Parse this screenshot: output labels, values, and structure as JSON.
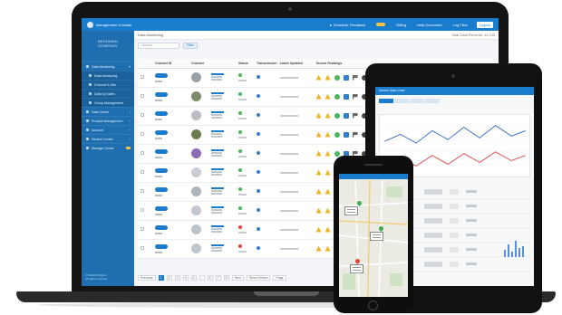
{
  "laptop": {
    "topbar": {
      "brand": "Management Console",
      "user_link": "Schedule Feedback",
      "items": [
        "Billing",
        "Help Document",
        "Log Files"
      ],
      "logout_label": "Logout"
    },
    "sidebar": {
      "logo_line1": "BEHUMAN",
      "logo_line2": "COMPANY",
      "items": [
        {
          "label": "Data Monitoring",
          "type": "main"
        },
        {
          "label": "Data Monitoring",
          "type": "sub"
        },
        {
          "label": "Channel & Site",
          "type": "sub"
        },
        {
          "label": "Data by Dates",
          "type": "sub"
        },
        {
          "label": "Group Management",
          "type": "sub"
        },
        {
          "label": "Data Center",
          "type": "main"
        },
        {
          "label": "Product Management",
          "type": "main"
        },
        {
          "label": "Account",
          "type": "main"
        },
        {
          "label": "Service Center",
          "type": "main"
        },
        {
          "label": "Manage Center",
          "type": "main"
        }
      ],
      "footer_line1": "© 2019 All Rights",
      "footer_line2": "All rights reserved"
    },
    "breadcrumb": "Data Monitoring",
    "breadcrumb_right": "Total Data Records: 11,130",
    "search_placeholder": "Search",
    "filter_button": "Filter",
    "table": {
      "headers": [
        "",
        "Channel ID",
        "Channel",
        "",
        "Status",
        "Transmission",
        "Latest Updated",
        "Sensor Readings"
      ],
      "rows": [
        {
          "status": "green"
        },
        {
          "status": "green"
        },
        {
          "status": "green"
        },
        {
          "status": "green"
        },
        {
          "status": "green"
        },
        {
          "status": "green"
        },
        {
          "status": "green"
        },
        {
          "status": "green"
        },
        {
          "status": "red"
        },
        {
          "status": "red"
        }
      ]
    },
    "pager": {
      "prev": "Previous",
      "pages": [
        "1",
        "2",
        "3",
        "4",
        "5",
        "...",
        "6",
        "7",
        "8"
      ],
      "next": "Next",
      "per_page": "Show Entries",
      "go": "Page"
    }
  },
  "tablet": {
    "title": "Device Data Chart"
  },
  "phone": {
    "title": "Map"
  },
  "colors": {
    "brand_blue": "#1a7ccc",
    "sidebar_blue": "#1f6fb0",
    "ok_green": "#49b85b",
    "alert_red": "#e0443a"
  }
}
